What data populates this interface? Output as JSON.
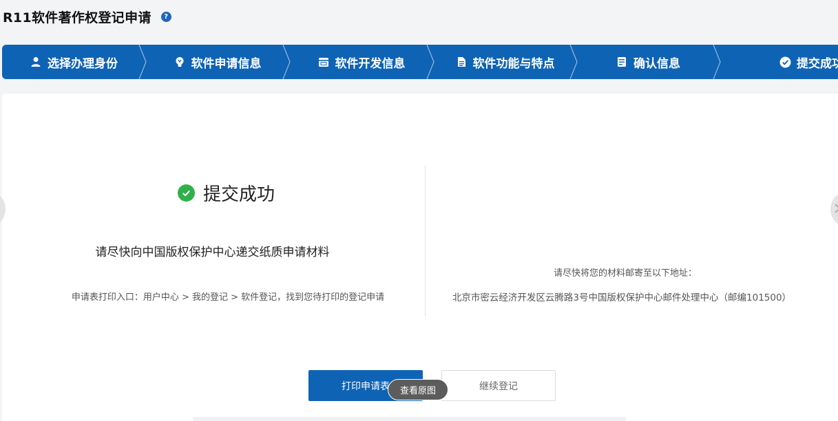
{
  "header": {
    "title": "R11软件著作权登记申请",
    "help_glyph": "?"
  },
  "steps": [
    {
      "label": "选择办理身份",
      "icon": "user-icon"
    },
    {
      "label": "软件申请信息",
      "icon": "lightbulb-icon"
    },
    {
      "label": "软件开发信息",
      "icon": "calendar-icon"
    },
    {
      "label": "软件功能与特点",
      "icon": "document-icon"
    },
    {
      "label": "确认信息",
      "icon": "id-card-icon"
    },
    {
      "label": "提交成功",
      "icon": "check-circle-icon"
    }
  ],
  "result": {
    "title": "提交成功",
    "instruction": "请尽快向中国版权保护中心递交纸质申请材料",
    "print_entry": "申请表打印入口：用户中心 > 我的登记 > 软件登记，找到您待打印的登记申请",
    "mail_hint": "请尽快将您的材料邮寄至以下地址：",
    "address": "北京市密云经济开发区云腾路3号中国版权保护中心邮件处理中心（邮编101500）"
  },
  "buttons": {
    "print": "打印申请表",
    "continue": "继续登记"
  },
  "tooltip": {
    "label": "查看原图"
  },
  "colors": {
    "primary": "#0f63b4",
    "success": "#2fb04a",
    "background": "#f3f4f6"
  }
}
